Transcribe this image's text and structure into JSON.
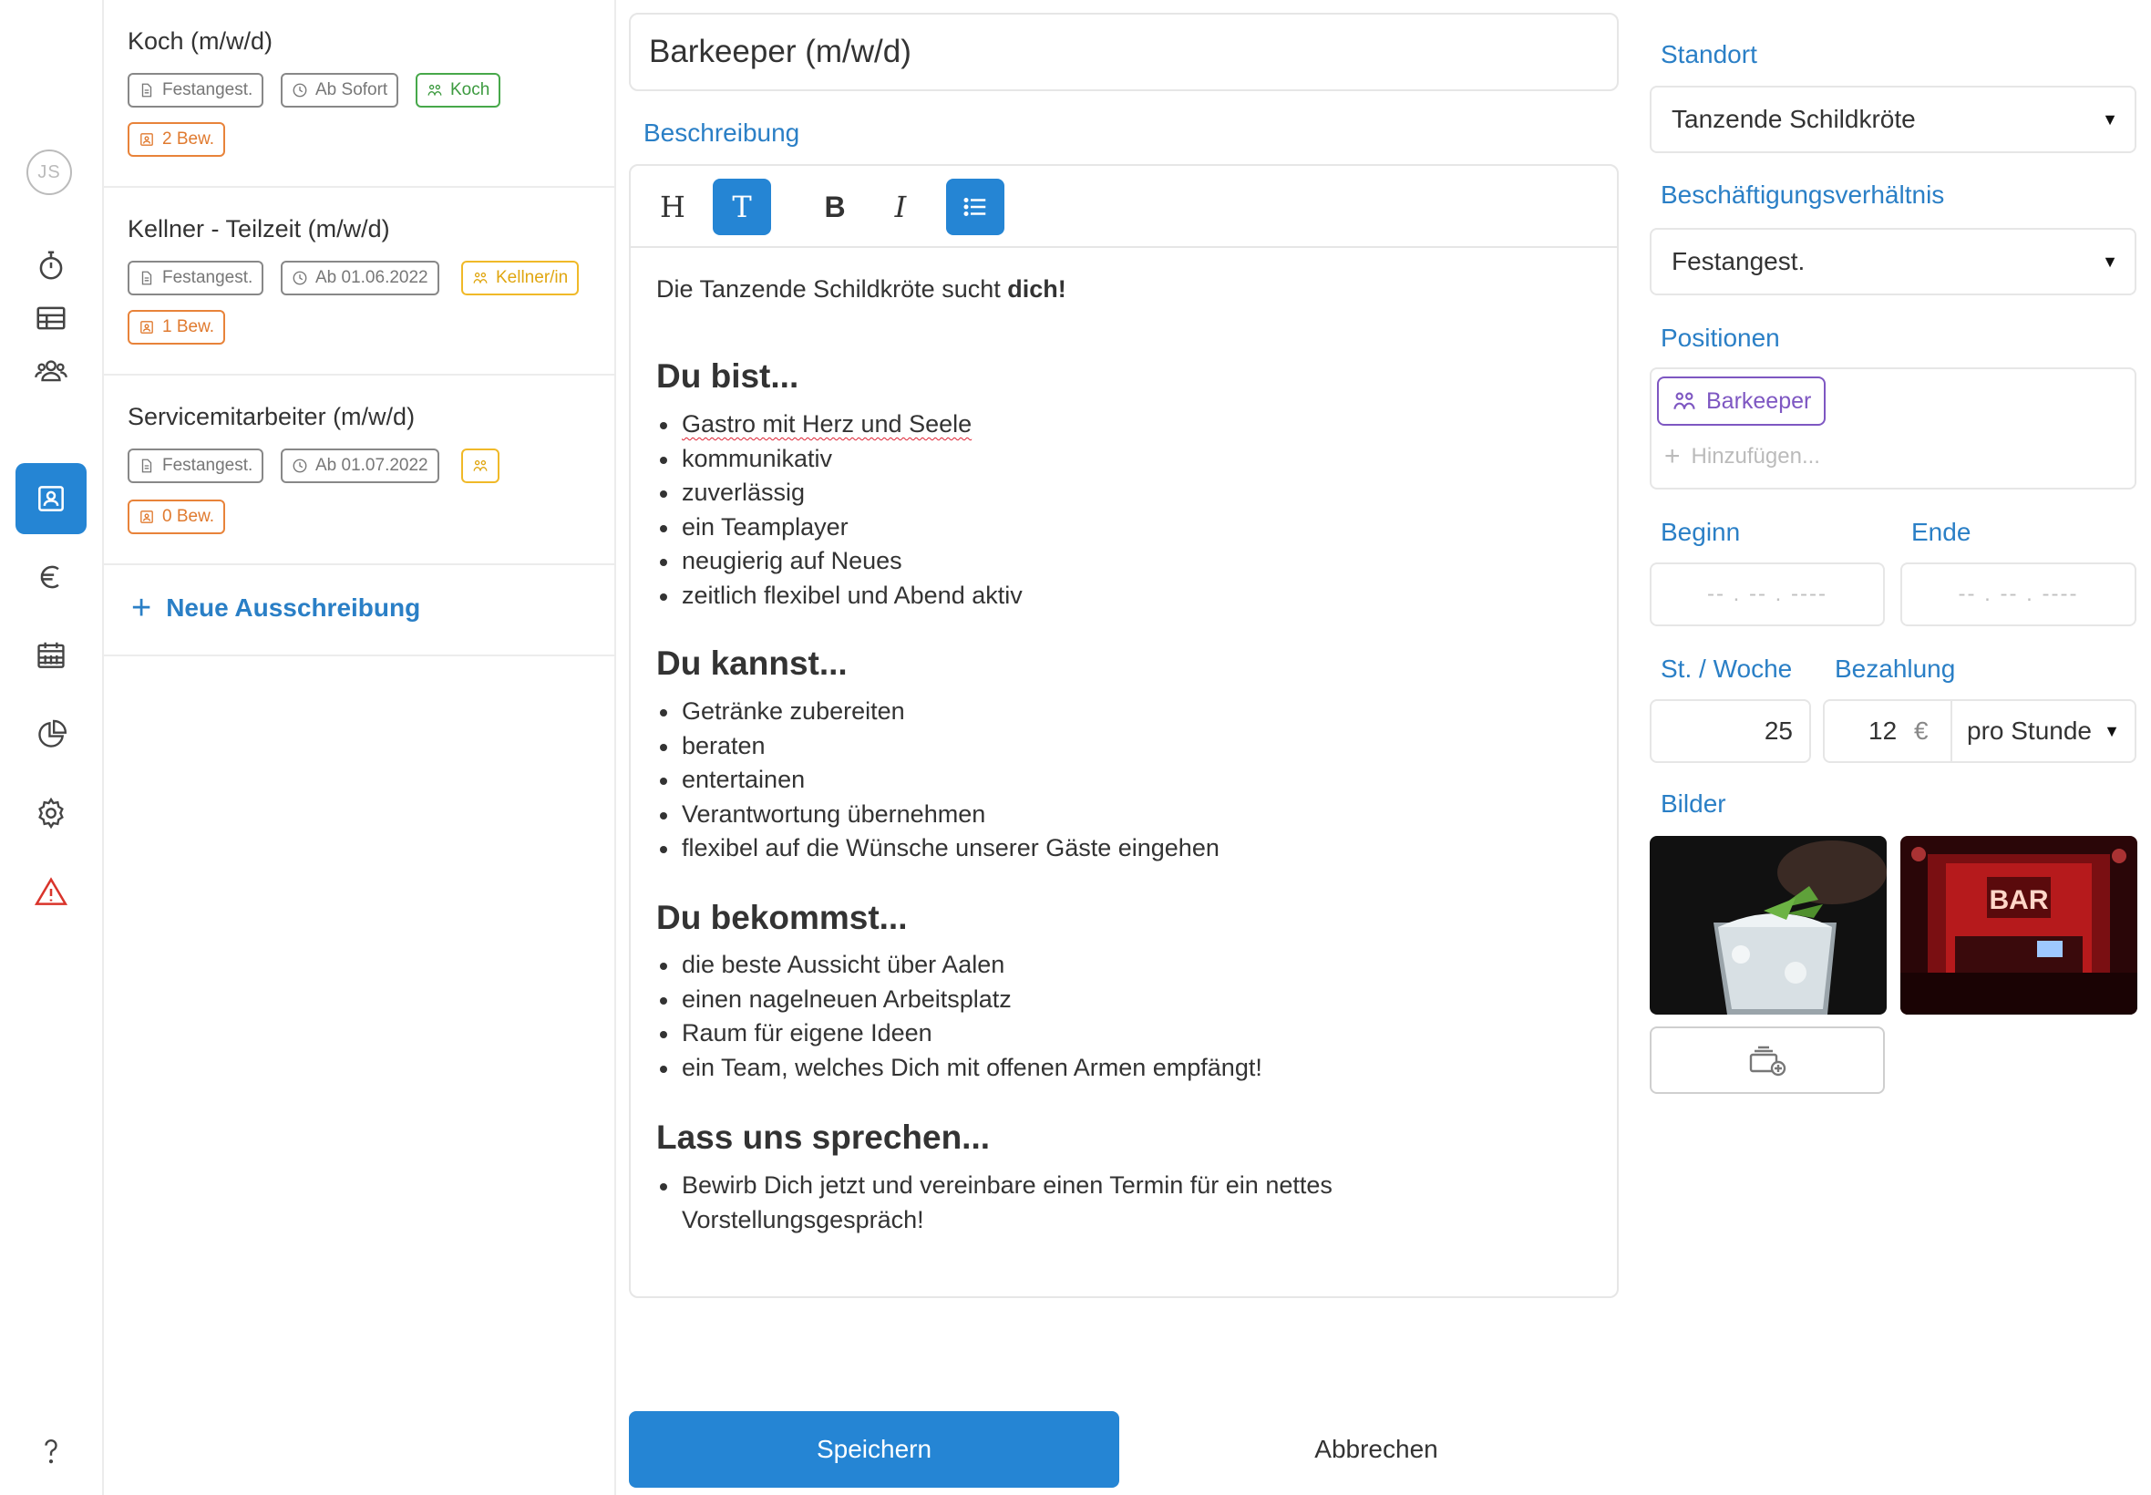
{
  "sidebar": {
    "avatar_initials": "JS",
    "items": [
      {
        "icon": "stopwatch-icon"
      },
      {
        "icon": "table-icon"
      },
      {
        "icon": "users-icon"
      },
      {
        "icon": "contact-card-icon",
        "active": true
      },
      {
        "icon": "euro-icon"
      },
      {
        "icon": "calendar-icon"
      },
      {
        "icon": "pie-chart-icon"
      },
      {
        "icon": "gear-icon"
      },
      {
        "icon": "warning-icon"
      }
    ],
    "help_icon": "question-icon"
  },
  "jobs": [
    {
      "title": "Koch (m/w/d)",
      "type": "Festangest.",
      "start": "Ab Sofort",
      "position": "Koch",
      "applications": "2 Bew."
    },
    {
      "title": "Kellner - Teilzeit (m/w/d)",
      "type": "Festangest.",
      "start": "Ab 01.06.2022",
      "position": "Kellner/in",
      "applications": "1 Bew."
    },
    {
      "title": "Servicemitarbeiter (m/w/d)",
      "type": "Festangest.",
      "start": "Ab 01.07.2022",
      "position": "",
      "applications": "0 Bew."
    }
  ],
  "new_job_label": "Neue Ausschreibung",
  "editor": {
    "title": "Barkeeper (m/w/d)",
    "description_label": "Beschreibung",
    "toolbar": {
      "heading": "H",
      "text": "T",
      "bold": "B",
      "italic": "I"
    },
    "intro": "Die Tanzende Schildkröte sucht ",
    "intro_bold": "dich!",
    "sections": [
      {
        "heading": "Du bist...",
        "items": [
          "Gastro mit Herz und Seele",
          "kommunikativ",
          "zuverlässig",
          "ein Teamplayer",
          "neugierig auf Neues",
          "zeitlich flexibel und Abend aktiv"
        ]
      },
      {
        "heading": "Du kannst...",
        "items": [
          "Getränke zubereiten",
          "beraten",
          "entertainen",
          "Verantwortung übernehmen",
          "flexibel auf die Wünsche unserer Gäste eingehen"
        ]
      },
      {
        "heading": "Du bekommst...",
        "items": [
          "die beste Aussicht über Aalen",
          "einen nagelneuen Arbeitsplatz",
          "Raum für eigene Ideen",
          "ein Team, welches Dich mit offenen Armen empfängt!"
        ]
      },
      {
        "heading": "Lass uns sprechen...",
        "items": [
          "Bewirb Dich jetzt und vereinbare einen Termin für ein nettes Vorstellungsgespräch!"
        ]
      }
    ]
  },
  "right": {
    "standort_label": "Standort",
    "standort_value": "Tanzende Schildkröte",
    "employment_label": "Beschäftigungsverhältnis",
    "employment_value": "Festangest.",
    "positions_label": "Positionen",
    "position_chip": "Barkeeper",
    "add_position": "Hinzufügen...",
    "begin_label": "Beginn",
    "end_label": "Ende",
    "begin_placeholder": "-- . -- . ----",
    "end_placeholder": "-- . -- . ----",
    "hours_label": "St. / Woche",
    "hours_value": "25",
    "pay_label": "Bezahlung",
    "pay_value": "12",
    "currency": "€",
    "pay_unit": "pro Stunde",
    "images_label": "Bilder",
    "bar_sign": "BAR"
  },
  "actions": {
    "save": "Speichern",
    "cancel": "Abbrechen"
  },
  "colors": {
    "accent": "#2585d4",
    "link": "#2a7fc6",
    "purple": "#7e57c2",
    "green": "#47a84a",
    "yellow": "#f0b928",
    "orange": "#e8833a",
    "warning": "#d9342b"
  }
}
